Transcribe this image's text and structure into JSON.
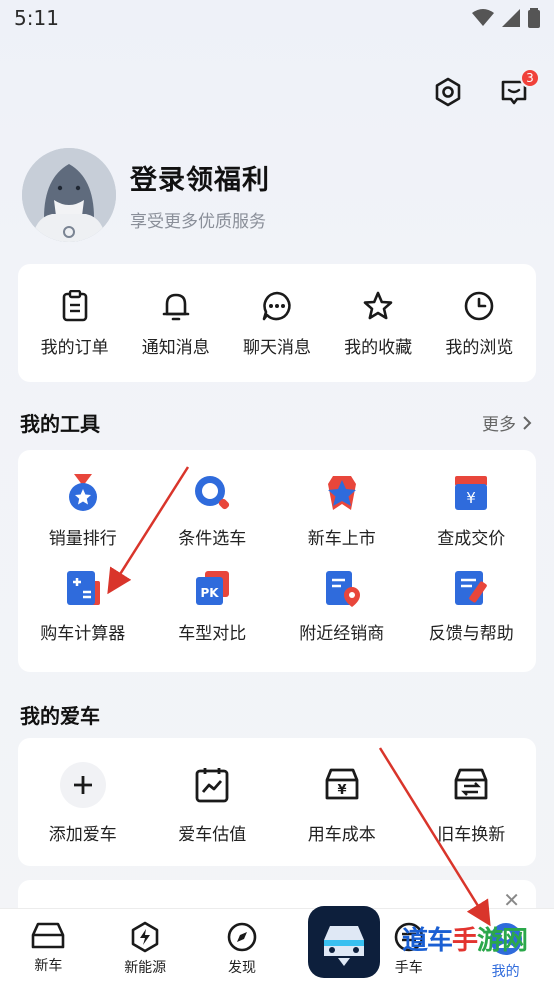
{
  "status_bar": {
    "time": "5:11"
  },
  "header": {
    "message_badge": "3"
  },
  "profile": {
    "title": "登录领福利",
    "subtitle": "享受更多优质服务"
  },
  "quick": [
    {
      "label": "我的订单",
      "icon": "order-icon"
    },
    {
      "label": "通知消息",
      "icon": "bell-icon"
    },
    {
      "label": "聊天消息",
      "icon": "chat-icon"
    },
    {
      "label": "我的收藏",
      "icon": "star-icon"
    },
    {
      "label": "我的浏览",
      "icon": "clock-icon"
    }
  ],
  "tools": {
    "title": "我的工具",
    "more": "更多",
    "items": [
      {
        "label": "销量排行",
        "icon": "medal-icon"
      },
      {
        "label": "条件选车",
        "icon": "search-icon"
      },
      {
        "label": "新车上市",
        "icon": "star-badge-icon"
      },
      {
        "label": "查成交价",
        "icon": "price-icon"
      },
      {
        "label": "购车计算器",
        "icon": "calculator-icon"
      },
      {
        "label": "车型对比",
        "icon": "pk-icon"
      },
      {
        "label": "附近经销商",
        "icon": "location-icon"
      },
      {
        "label": "反馈与帮助",
        "icon": "feedback-icon"
      }
    ]
  },
  "my_car": {
    "title": "我的爱车",
    "items": [
      {
        "label": "添加爱车",
        "icon": "plus-icon"
      },
      {
        "label": "爱车估值",
        "icon": "chart-clipboard-icon"
      },
      {
        "label": "用车成本",
        "icon": "yen-car-icon"
      },
      {
        "label": "旧车换新",
        "icon": "swap-car-icon"
      }
    ]
  },
  "tabbar": [
    {
      "label": "新车",
      "icon": "car-icon"
    },
    {
      "label": "新能源",
      "icon": "bolt-icon"
    },
    {
      "label": "发现",
      "icon": "compass-icon"
    },
    {
      "label": "手车",
      "icon": "used-car-icon"
    },
    {
      "label": "我的",
      "icon": "profile-icon"
    }
  ],
  "watermark": {
    "part1": "道车",
    "part2": "手",
    "part3": "游网"
  },
  "colors": {
    "accent": "#2f6bdc",
    "red": "#e8463b",
    "arrow": "#d9352b"
  }
}
